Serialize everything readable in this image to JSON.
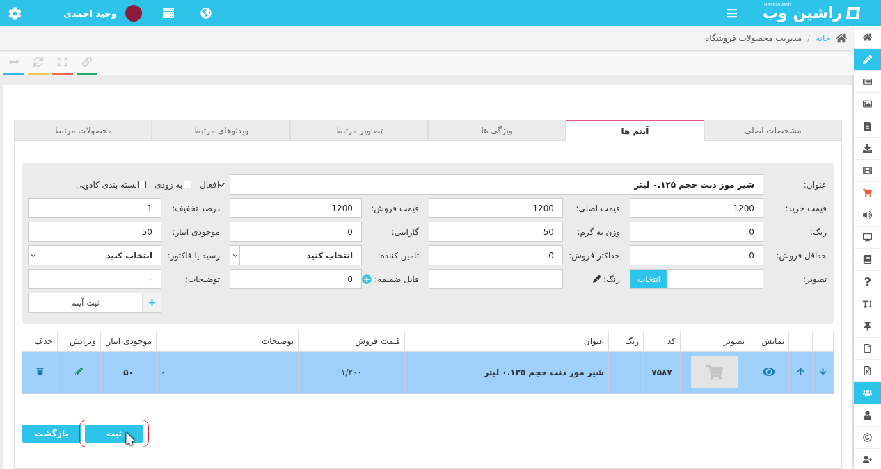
{
  "header": {
    "logo": {
      "name": "راشین وب",
      "latin": "RashinWeb"
    },
    "user_name": "وحید احمدی"
  },
  "breadcrumb": {
    "items": [
      {
        "label": "خانه",
        "link": true
      },
      {
        "label": "مدیریت محصولات فروشگاه",
        "link": false
      }
    ],
    "separator": "/"
  },
  "toolbar": {
    "buttons": [
      {
        "color": "#2fb8e6"
      },
      {
        "color": "#fdc647"
      },
      {
        "color": "#f36a4f"
      },
      {
        "color": "#1eaf6b"
      }
    ]
  },
  "sidebar": {
    "items": [
      {
        "selected": false
      },
      {
        "selected": true
      },
      {
        "selected": false
      },
      {
        "selected": false
      },
      {
        "selected": false
      },
      {
        "selected": false
      },
      {
        "selected": false
      },
      {
        "selected": false
      },
      {
        "selected": false
      },
      {
        "selected": false
      },
      {
        "selected": false
      },
      {
        "selected": false
      },
      {
        "selected": false
      },
      {
        "selected": false
      },
      {
        "selected": false
      },
      {
        "selected": false
      },
      {
        "selected": true
      },
      {
        "selected": false
      },
      {
        "selected": false
      },
      {
        "selected": false
      }
    ]
  },
  "tabs": [
    {
      "label": "مشخصات اصلی",
      "selected": false
    },
    {
      "label": "آیتم ها",
      "selected": true
    },
    {
      "label": "ویژگی ها",
      "selected": false
    },
    {
      "label": "تصاویر مرتبط",
      "selected": false
    },
    {
      "label": "ویدئوهای مرتبط",
      "selected": false
    },
    {
      "label": "محصولات مرتبط",
      "selected": false
    }
  ],
  "form": {
    "rows": [
      {
        "fields": [
          {
            "kind": "wide",
            "label": "عنوان:",
            "value": "شیر موز دنت حجم ۰.۱۲۵ لیتر"
          },
          {
            "kind": "checks",
            "options": [
              {
                "label": "فعال",
                "checked": true
              },
              {
                "label": "به زودی",
                "checked": false
              },
              {
                "label": "بسته بندی کادویی",
                "checked": false
              }
            ]
          }
        ]
      },
      {
        "fields": [
          {
            "kind": "text",
            "label": "قیمت خرید:",
            "value": "1200"
          },
          {
            "kind": "text",
            "label": "قیمت اصلی:",
            "value": "1200"
          },
          {
            "kind": "text",
            "label": "قیمت فروش:",
            "value": "1200"
          },
          {
            "kind": "text",
            "label": "درصد تخفیف:",
            "value": "1"
          }
        ]
      },
      {
        "fields": [
          {
            "kind": "text",
            "label": "رنگ:",
            "value": "0"
          },
          {
            "kind": "text",
            "label": "وزن به گرم:",
            "value": "50"
          },
          {
            "kind": "text",
            "label": "گارانتی:",
            "value": "0"
          },
          {
            "kind": "text",
            "label": "موجودی انبار:",
            "value": "50"
          }
        ]
      },
      {
        "fields": [
          {
            "kind": "text",
            "label": "حداقل فروش:",
            "value": "0"
          },
          {
            "kind": "text",
            "label": "حداکثر فروش:",
            "value": "0"
          },
          {
            "kind": "select",
            "label": "تامین کننده:",
            "value": "انتخاب کنید"
          },
          {
            "kind": "select",
            "label": "رسید یا فاکتور:",
            "value": "انتخاب کنید"
          }
        ]
      },
      {
        "fields": [
          {
            "kind": "file",
            "label": "تصویر:",
            "button": "انتخاب"
          },
          {
            "kind": "color",
            "label": "رنگ:"
          },
          {
            "kind": "attachment",
            "label": "فایل ضمیمه:",
            "value": "0"
          },
          {
            "kind": "text",
            "label": "توضیحات:",
            "value": "۰"
          }
        ]
      },
      {
        "fields": [
          {
            "kind": "add-button",
            "label": "ثبت آیتم"
          }
        ]
      }
    ]
  },
  "table": {
    "columns": [
      "نمایش",
      "تصویر",
      "کد",
      "رنگ",
      "عنوان",
      "قیمت فروش",
      "توضیحات",
      "موجودی انبار",
      "ویرایش",
      "حذف"
    ],
    "rows": [
      {
        "selected": true,
        "code": "۷۵۸۷",
        "title": "شیر موز دنت حجم ۰.۱۲۵ لیتر",
        "price": "۱/۲۰۰",
        "description": "۰",
        "stock": "۵۰"
      }
    ]
  },
  "buttons": [
    {
      "label": "ثبت",
      "highlighted": true
    },
    {
      "label": "بازگشت",
      "highlighted": false
    }
  ]
}
